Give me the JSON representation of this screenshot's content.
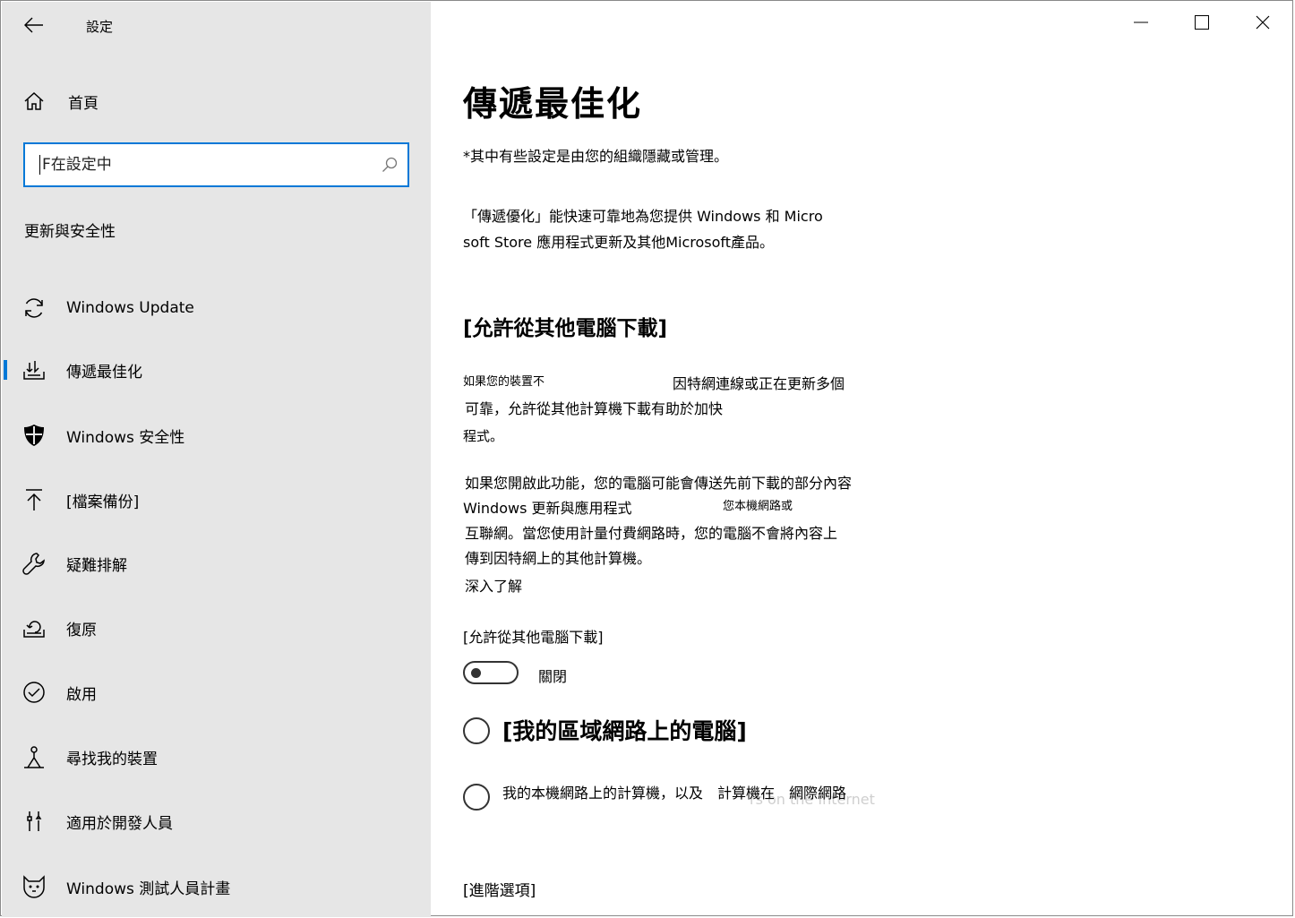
{
  "app": {
    "title": "設定"
  },
  "sidebar": {
    "home_label": "首頁",
    "search_placeholder": "F在設定中",
    "section_title": "更新與安全性",
    "items": [
      {
        "label": "Windows Update",
        "icon": "sync-icon"
      },
      {
        "label": "傳遞最佳化",
        "icon": "delivery-optimization-icon",
        "selected": true
      },
      {
        "label": "Windows 安全性",
        "icon": "shield-icon"
      },
      {
        "label": "[檔案備份]",
        "icon": "upload-arrow-icon"
      },
      {
        "label": "疑難排解",
        "icon": "wrench-icon"
      },
      {
        "label": "復原",
        "icon": "recovery-icon"
      },
      {
        "label": "啟用",
        "icon": "check-circle-icon"
      },
      {
        "label": "尋找我的裝置",
        "icon": "find-device-icon"
      },
      {
        "label": "適用於開發人員",
        "icon": "developer-tools-icon"
      },
      {
        "label": "Windows 測試人員計畫",
        "icon": "insider-cat-icon"
      }
    ]
  },
  "main": {
    "title": "傳遞最佳化",
    "managed_note": "*其中有些設定是由您的組織隱藏或管理。",
    "description_line1": "「傳遞優化」能快速可靠地為您提供 Windows 和 Micro",
    "description_line2": "soft Store 應用程式更新及其他Microsoft產品。",
    "allow_heading": "[允許從其他電腦下載]",
    "para1_a": "如果您的裝置不",
    "para1_b": "因特網連線或正在更新多個",
    "para1_c": "可靠，允許從其他計算機下載有助於加快",
    "para1_d": "程式。",
    "para2_line1": "如果您開啟此功能，您的電腦可能會傳送先前下載的部分內容",
    "para2_line2a": "Windows 更新與應用程式",
    "para2_line2b": "您本機網路或",
    "para2_line3": "互聯網。當您使用計量付費網路時，您的電腦不會將內容上",
    "para2_line4": "傳到因特網上的其他計算機。",
    "learn_more": "深入了解",
    "toggle_label": "[允許從其他電腦下載]",
    "toggle_state": "關閉",
    "radio1_label": "[我的區域網路上的電腦]",
    "radio2_label": "我的本機網路上的計算機，以及　計算機在　網際網路",
    "radio2_ghost": "rs on the Internet",
    "advanced_link": "[進階選項]"
  },
  "colors": {
    "accent": "#0078d7",
    "sidebar_bg": "#e6e6e6"
  }
}
